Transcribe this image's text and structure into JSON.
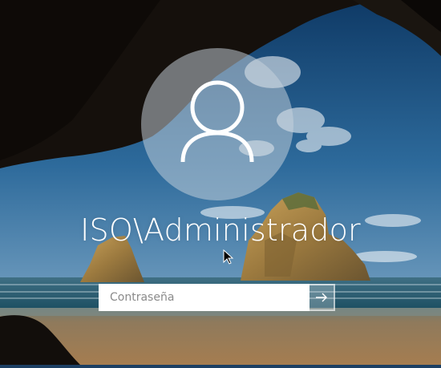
{
  "login": {
    "username": "ISO\\Administrador",
    "password_placeholder": "Contraseña",
    "password_value": ""
  },
  "icons": {
    "avatar": "user-silhouette-icon",
    "submit": "arrow-right-icon",
    "pointer": "mouse-pointer-icon"
  },
  "colors": {
    "sky": "#2a5d8f",
    "sea": "#1e5a72",
    "sand": "#a07a4e",
    "avatar_fill": "#c8d2dc"
  }
}
